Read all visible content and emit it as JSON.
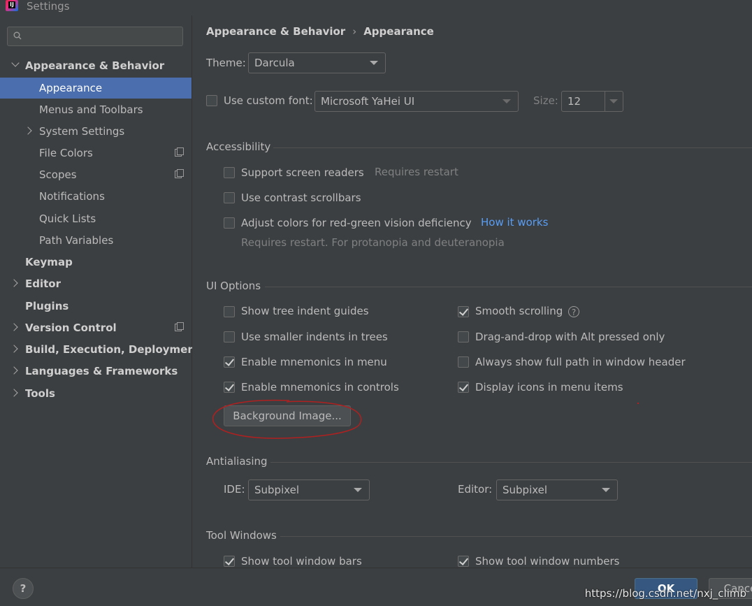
{
  "window": {
    "title": "Settings",
    "icon_text": "IJ"
  },
  "sidebar": {
    "search": {
      "placeholder": "",
      "value": ""
    },
    "items": [
      {
        "label": "Appearance & Behavior"
      },
      {
        "label": "Appearance"
      },
      {
        "label": "Menus and Toolbars"
      },
      {
        "label": "System Settings"
      },
      {
        "label": "File Colors"
      },
      {
        "label": "Scopes"
      },
      {
        "label": "Notifications"
      },
      {
        "label": "Quick Lists"
      },
      {
        "label": "Path Variables"
      },
      {
        "label": "Keymap"
      },
      {
        "label": "Editor"
      },
      {
        "label": "Plugins"
      },
      {
        "label": "Version Control"
      },
      {
        "label": "Build, Execution, Deployment"
      },
      {
        "label": "Languages & Frameworks"
      },
      {
        "label": "Tools"
      }
    ]
  },
  "main": {
    "breadcrumb": {
      "parent": "Appearance & Behavior",
      "separator": "›",
      "current": "Appearance"
    },
    "theme": {
      "label": "Theme:",
      "value": "Darcula"
    },
    "custom_font": {
      "label": "Use custom font:",
      "checked": false,
      "value": "Microsoft YaHei UI",
      "size_label": "Size:",
      "size_value": "12"
    },
    "accessibility": {
      "title": "Accessibility",
      "screen_readers": {
        "label": "Support screen readers",
        "checked": false,
        "note": "Requires restart"
      },
      "contrast_scrollbars": {
        "label": "Use contrast scrollbars",
        "checked": false
      },
      "color_deficiency": {
        "label": "Adjust colors for red-green vision deficiency",
        "checked": false,
        "link": "How it works",
        "note": "Requires restart. For protanopia and deuteranopia"
      }
    },
    "ui_options": {
      "title": "UI Options",
      "left": [
        {
          "label": "Show tree indent guides",
          "checked": false
        },
        {
          "label": "Use smaller indents in trees",
          "checked": false
        },
        {
          "label": "Enable mnemonics in menu",
          "checked": true
        },
        {
          "label": "Enable mnemonics in controls",
          "checked": true
        }
      ],
      "right": [
        {
          "label": "Smooth scrolling",
          "checked": true
        },
        {
          "label": "Drag-and-drop with Alt pressed only",
          "checked": false
        },
        {
          "label": "Always show full path in window header",
          "checked": false
        },
        {
          "label": "Display icons in menu items",
          "checked": true
        }
      ],
      "help_glyph": "?",
      "background_image_button": "Background Image..."
    },
    "antialiasing": {
      "title": "Antialiasing",
      "ide_label": "IDE:",
      "ide_value": "Subpixel",
      "editor_label": "Editor:",
      "editor_value": "Subpixel"
    },
    "tool_windows": {
      "title": "Tool Windows",
      "show_bars": {
        "label": "Show tool window bars",
        "checked": true
      },
      "show_numbers": {
        "label": "Show tool window numbers",
        "checked": true
      }
    }
  },
  "footer": {
    "help": "?",
    "ok": "OK",
    "cancel": "Cance"
  },
  "watermark": "https://blog.csdn.net/nxj_climb",
  "colors": {
    "selection": "#4b6eaf",
    "link": "#589df6",
    "annotation": "#b02020",
    "background": "#3c3f41"
  }
}
